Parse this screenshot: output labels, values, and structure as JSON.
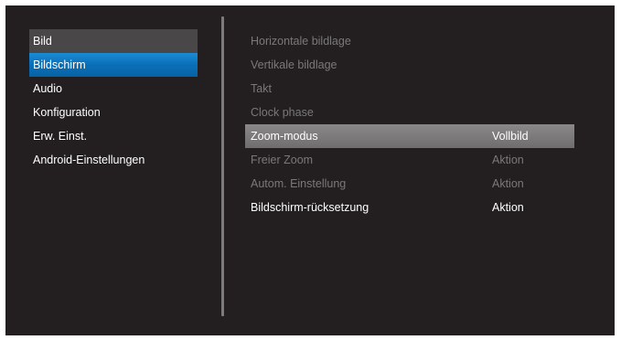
{
  "left_menu": {
    "items": [
      {
        "label": "Bild",
        "state": "parent"
      },
      {
        "label": "Bildschirm",
        "state": "active"
      },
      {
        "label": "Audio",
        "state": "normal"
      },
      {
        "label": "Konfiguration",
        "state": "normal"
      },
      {
        "label": "Erw. Einst.",
        "state": "normal"
      },
      {
        "label": "Android-Einstellungen",
        "state": "normal"
      }
    ]
  },
  "right_menu": {
    "rows": [
      {
        "label": "Horizontale bildlage",
        "value": "",
        "state": "disabled"
      },
      {
        "label": "Vertikale bildlage",
        "value": "",
        "state": "disabled"
      },
      {
        "label": "Takt",
        "value": "",
        "state": "disabled"
      },
      {
        "label": "Clock phase",
        "value": "",
        "state": "disabled"
      },
      {
        "label": "Zoom-modus",
        "value": "Vollbild",
        "state": "selected"
      },
      {
        "label": "Freier Zoom",
        "value": "Aktion",
        "state": "disabled"
      },
      {
        "label": "Autom. Einstellung",
        "value": "Aktion",
        "state": "disabled"
      },
      {
        "label": "Bildschirm-rücksetzung",
        "value": "Aktion",
        "state": "enabled"
      }
    ]
  },
  "colors": {
    "background": "#231f20",
    "active_blue": "#0a6fb7",
    "selected_grey": "#7a7879",
    "disabled_text": "#7a7879",
    "text": "#ffffff"
  }
}
